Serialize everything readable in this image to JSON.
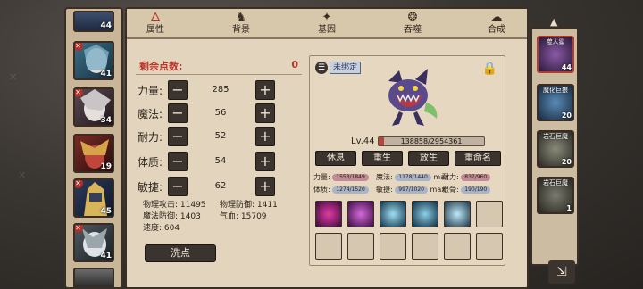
{
  "tabs": [
    {
      "icon": "🜂",
      "label": "属性"
    },
    {
      "icon": "♞",
      "label": "背景"
    },
    {
      "icon": "✦",
      "label": "基因"
    },
    {
      "icon": "❂",
      "label": "吞噬"
    },
    {
      "icon": "☁",
      "label": "合成"
    }
  ],
  "allocation": {
    "remaining_label": "剩余点数:",
    "remaining_value": "0",
    "stats": [
      {
        "label": "力量:",
        "value": "285"
      },
      {
        "label": "魔法:",
        "value": "56"
      },
      {
        "label": "耐力:",
        "value": "52"
      },
      {
        "label": "体质:",
        "value": "54"
      },
      {
        "label": "敏捷:",
        "value": "62"
      }
    ],
    "minus_symbol": "−",
    "plus_symbol": "+",
    "derived": {
      "phys_atk": "物理攻击: 11495",
      "phys_def": "物理防御: 1411",
      "mag_def": "魔法防御: 1403",
      "qi_xue": "气血: 15709",
      "speed": "速度: 604"
    },
    "wash_button": "洗点"
  },
  "pet": {
    "unbound_tag": "未绑定",
    "level": "Lv.44",
    "exp_text": "138858/2954361",
    "exp_progress": 0.047,
    "actions": [
      "休息",
      "重生",
      "放生",
      "重命名"
    ],
    "stats": [
      {
        "label": "力量:",
        "value": "1553/1849",
        "color": "#c38a95"
      },
      {
        "label": "魔法:",
        "value": "1178/1440",
        "color": "#a9b4c8"
      },
      {
        "label": "耐力:",
        "value": "837/960",
        "color": "#c38a95"
      },
      {
        "label": "体质:",
        "value": "1274/1520",
        "color": "#a9b4c8"
      },
      {
        "label": "敏捷:",
        "value": "997/1020",
        "color": "#a9b4c8"
      },
      {
        "label": "根骨:",
        "value": "190/190",
        "color": "#a9b4c8"
      }
    ],
    "max_tag": "max",
    "skills": [
      "skill-1-icon",
      "skill-2-icon",
      "skill-3-icon",
      "skill-4-icon",
      "skill-5-icon"
    ]
  },
  "left_roster": [
    "44",
    "41",
    "34",
    "19",
    "45",
    "41"
  ],
  "right_roster": [
    {
      "name": "噬人鲨",
      "level": "44"
    },
    {
      "name": "魔化巨狼",
      "level": "20"
    },
    {
      "name": "岩石巨魔",
      "level": "20"
    },
    {
      "name": "岩石巨魔",
      "level": "1"
    }
  ],
  "close_icon": "⇲"
}
